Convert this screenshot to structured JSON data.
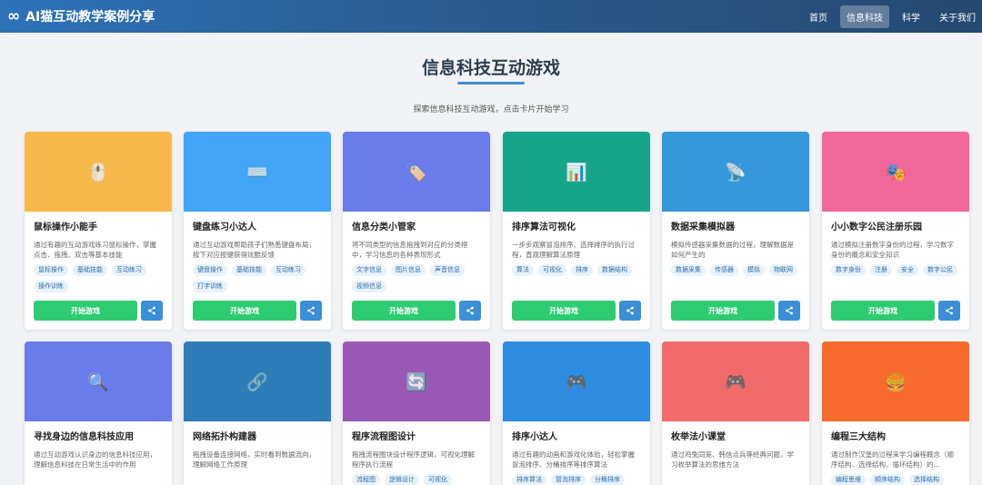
{
  "brand": {
    "icon": "∞",
    "title": "AI猫互动教学案例分享"
  },
  "nav": [
    {
      "label": "首页",
      "active": false
    },
    {
      "label": "信息科技",
      "active": true
    },
    {
      "label": "科学",
      "active": false
    },
    {
      "label": "关于我们",
      "active": false
    }
  ],
  "page": {
    "title": "信息科技互动游戏",
    "subtitle": "探索信息科技互动游戏，点击卡片开始学习"
  },
  "play_label": "开始游戏",
  "share_icon": "share-icon",
  "cards": [
    {
      "title": "鼠标操作小能手",
      "desc": "通过有趣的互动游戏练习鼠标操作，掌握点击、拖拽、双击等基本技能",
      "tags": [
        "鼠标操作",
        "基础技能",
        "互动练习",
        "操作训练"
      ],
      "color": "#f7b84b",
      "icon": "mouse-icon",
      "glyph": "🖱️"
    },
    {
      "title": "键盘练习小达人",
      "desc": "通过互动游戏帮助孩子们熟悉键盘布局，按下对应按键获得炫酷反馈",
      "tags": [
        "键盘操作",
        "基础技能",
        "互动练习",
        "打字训练"
      ],
      "color": "#42a5f5",
      "icon": "keyboard-icon",
      "glyph": "⌨️"
    },
    {
      "title": "信息分类小管家",
      "desc": "将不同类型的信息拖拽到对应的分类框中，学习信息的各种表现形式",
      "tags": [
        "文字信息",
        "图片信息",
        "声音信息",
        "视频信息"
      ],
      "color": "#6a7bea",
      "icon": "tag-icon",
      "glyph": "🏷️"
    },
    {
      "title": "排序算法可视化",
      "desc": "一步步观察冒泡排序、选择排序的执行过程，直观理解算法原理",
      "tags": [
        "算法",
        "可视化",
        "排序",
        "数据结构"
      ],
      "color": "#17a589",
      "icon": "bar-chart-icon",
      "glyph": "📊"
    },
    {
      "title": "数据采集模拟器",
      "desc": "模拟传感器采集数据的过程，理解数据是如何产生的",
      "tags": [
        "数据采集",
        "传感器",
        "模拟",
        "物联网"
      ],
      "color": "#3498db",
      "icon": "satellite-icon",
      "glyph": "📡"
    },
    {
      "title": "小小数字公民注册乐园",
      "desc": "通过模拟注册数字身份的过程，学习数字身份的概念和安全知识",
      "tags": [
        "数字身份",
        "注册",
        "安全",
        "数字公民"
      ],
      "color": "#f0679a",
      "icon": "theater-masks-icon",
      "glyph": "🎭"
    },
    {
      "title": "寻找身边的信息科技应用",
      "desc": "通过互动游戏认识身边的信息科技应用，理解信息科技在日常生活中的作用",
      "tags": [],
      "color": "#6a7bea",
      "icon": "magnifier-icon",
      "glyph": "🔍"
    },
    {
      "title": "网络拓扑构建器",
      "desc": "拖拽设备连接网络，实时看到数据流向，理解网络工作原理",
      "tags": [],
      "color": "#2e7db8",
      "icon": "link-icon",
      "glyph": "🔗"
    },
    {
      "title": "程序流程图设计",
      "desc": "拖拽流程图块设计程序逻辑，可视化理解程序执行流程",
      "tags": [
        "流程图",
        "逻辑设计",
        "可视化"
      ],
      "color": "#9b59b6",
      "icon": "cycle-icon",
      "glyph": "🔄"
    },
    {
      "title": "排序小达人",
      "desc": "通过有趣的动画和游戏化体验，轻松掌握冒泡排序、分桶排序等排序算法",
      "tags": [
        "排序算法",
        "冒泡排序",
        "分桶排序"
      ],
      "color": "#2e8de0",
      "icon": "gamepad-icon",
      "glyph": "🎮"
    },
    {
      "title": "枚举法小课堂",
      "desc": "通过鸡兔同笼、韩信点兵等经典问题，学习枚举算法的思维方法",
      "tags": [],
      "color": "#f26b6b",
      "icon": "gamepad-icon",
      "glyph": "🎮"
    },
    {
      "title": "编程三大结构",
      "desc": "通过制作汉堡的过程来学习编程概念（顺序结构、选择结构、循环结构）的...",
      "tags": [
        "编程思维",
        "顺序结构",
        "选择结构"
      ],
      "color": "#f76b2e",
      "icon": "hamburger-icon",
      "glyph": "🍔"
    }
  ]
}
